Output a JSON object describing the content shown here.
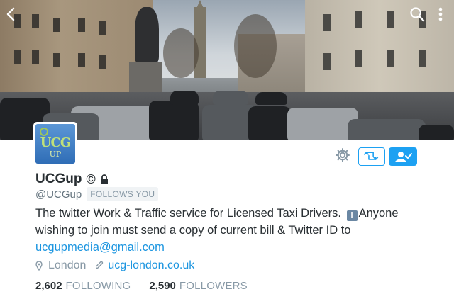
{
  "profile": {
    "display_name": "UCGup",
    "name_symbol": "©",
    "handle": "@UCGup",
    "follows_you_label": "FOLLOWS YOU",
    "bio_part1": "The twitter Work & Traffic service for Licensed Taxi Drivers. ",
    "bio_info_glyph": "i",
    "bio_part2": "Anyone wishing to join must send a copy of current bill & Twitter ID to ",
    "bio_email": "ucgupmedia@gmail.com",
    "location": "London",
    "website": "ucg-london.co.uk",
    "following_count": "2,602",
    "following_label": "FOLLOWING",
    "followers_count": "2,590",
    "followers_label": "FOLLOWERS"
  },
  "avatar": {
    "text_main": "UCG",
    "text_sub": "UP"
  },
  "icons": {
    "back": "chevron-left-icon",
    "search": "search-icon",
    "more": "more-vertical-icon",
    "gear": "gear-icon",
    "retweet": "retweet-icon",
    "following": "person-check-icon",
    "lock": "lock-icon",
    "pin": "location-pin-icon",
    "link": "link-icon"
  },
  "colors": {
    "accent": "#1da1f2",
    "link": "#1b95e0",
    "muted": "#8899a6",
    "text": "#292f33"
  }
}
